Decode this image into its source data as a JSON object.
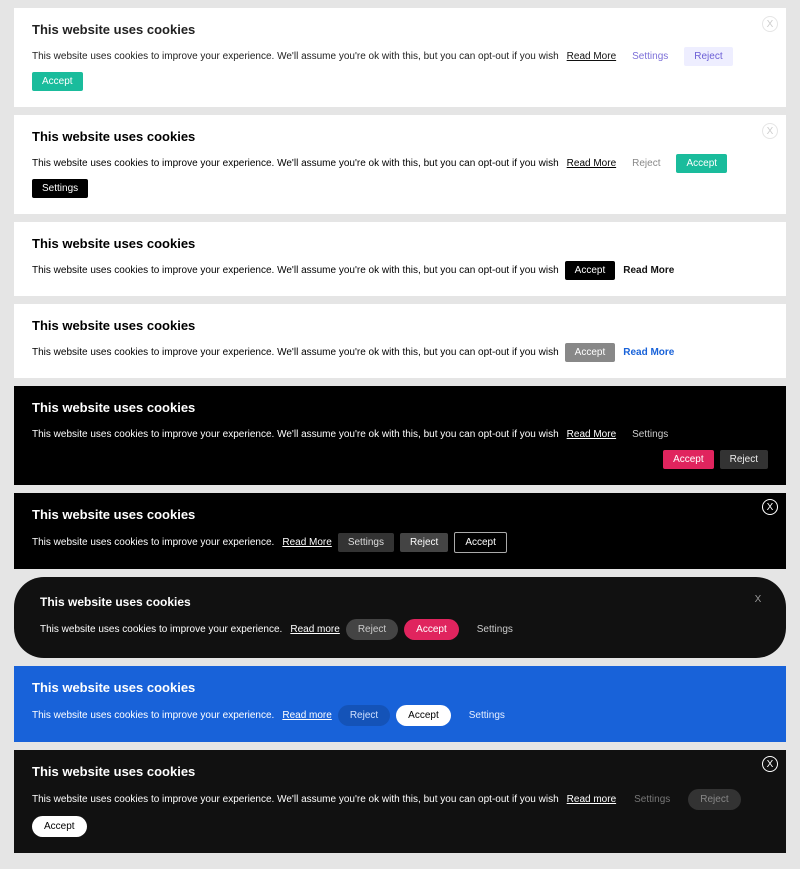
{
  "heading": "This website uses cookies",
  "descLong": "This website uses cookies to improve your experience. We'll assume you're ok with this, but you can opt-out if you wish",
  "descShort": "This website uses cookies to improve your experience.",
  "readMore": "Read More",
  "readMoreLc": "Read more",
  "settings": "Settings",
  "reject": "Reject",
  "accept": "Accept",
  "closeX": "X",
  "banners": [
    {
      "bg": "white",
      "scheme": "light-green-violet",
      "buttons": [
        "readmore",
        "settings",
        "reject",
        "accept"
      ],
      "hasClose": true
    },
    {
      "bg": "white",
      "scheme": "light-green-black",
      "buttons": [
        "readmore",
        "reject",
        "accept",
        "settings"
      ],
      "hasClose": true
    },
    {
      "bg": "white",
      "scheme": "light-black",
      "buttons": [
        "accept",
        "readmore"
      ],
      "hasClose": false
    },
    {
      "bg": "white",
      "scheme": "light-gray-bluelink",
      "buttons": [
        "accept",
        "readmore"
      ],
      "hasClose": false
    },
    {
      "bg": "black",
      "scheme": "dark-red",
      "buttons": [
        "readmore",
        "settings",
        "right-accept",
        "right-reject"
      ],
      "hasClose": false
    },
    {
      "bg": "black",
      "scheme": "dark-outline",
      "buttons": [
        "readmore",
        "settings",
        "reject",
        "accept"
      ],
      "hasClose": true,
      "short": true
    },
    {
      "bg": "black-round",
      "scheme": "dark-pink-pill",
      "buttons": [
        "readmore",
        "reject",
        "accept",
        "settings"
      ],
      "hasClose": true,
      "short": true
    },
    {
      "bg": "blue",
      "scheme": "blue-pill",
      "buttons": [
        "readmore",
        "reject",
        "accept",
        "settings"
      ],
      "hasClose": false,
      "short": true
    },
    {
      "bg": "black",
      "scheme": "dark-white-pill",
      "buttons": [
        "readmore",
        "settings",
        "reject",
        "accept"
      ],
      "hasClose": true
    }
  ]
}
